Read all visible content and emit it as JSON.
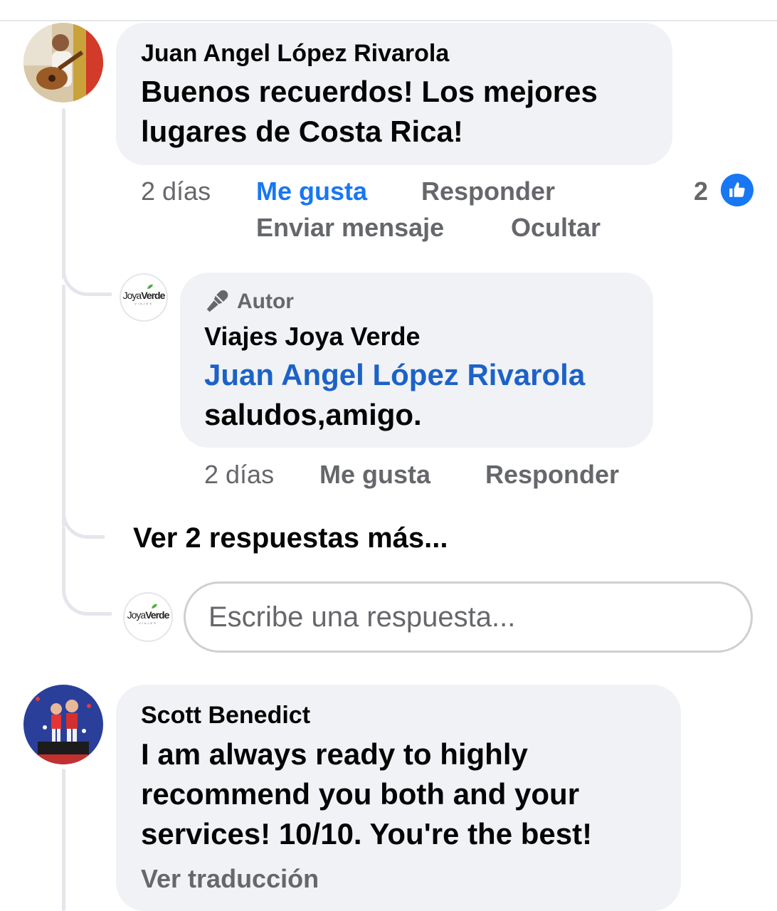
{
  "comments": [
    {
      "author": "Juan Angel López Rivarola",
      "text_lines": [
        "Buenos recuerdos! Los mejores",
        "lugares de Costa Rica!"
      ],
      "timestamp": "2 días",
      "like_label": "Me gusta",
      "reply_label": "Responder",
      "message_label": "Enviar mensaje",
      "hide_label": "Ocultar",
      "reaction_count": "2",
      "reaction_icon": "thumbs-up-icon",
      "avatar_icon": "guitar-player-photo"
    },
    {
      "author": "Scott Benedict",
      "text_lines": [
        "I am always ready to highly",
        "recommend you both and your",
        "services! 10/10. You're the best!"
      ],
      "see_translation": "Ver traducción",
      "avatar_icon": "children-on-podium-photo"
    }
  ],
  "reply": {
    "badge": "Autor",
    "badge_icon": "microphone-icon",
    "author": "Viajes Joya Verde",
    "mention": "Juan Angel López Rivarola",
    "text": "saludos,amigo.",
    "timestamp": "2 días",
    "like_label": "Me gusta",
    "reply_label": "Responder"
  },
  "logo": {
    "part1": "Joya",
    "part2": "Verde",
    "tagline": "VIAJES"
  },
  "view_more": "Ver 2 respuestas más...",
  "reply_input": {
    "placeholder": "Escribe una respuesta..."
  },
  "colors": {
    "link_blue": "#1877f2",
    "mention_blue": "#1c62c7",
    "secondary_text": "#65676b",
    "bubble": "#f0f2f5"
  }
}
